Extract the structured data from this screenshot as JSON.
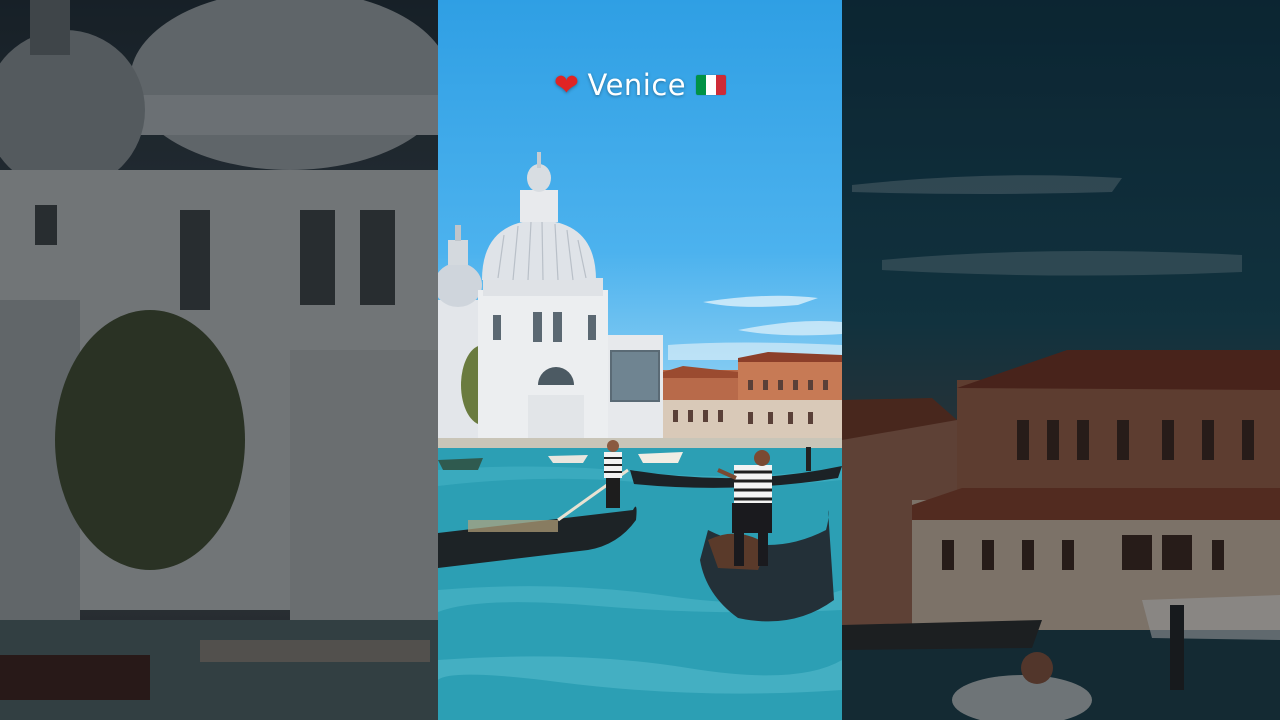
{
  "overlay": {
    "heart_glyph": "❤",
    "title": "Venice",
    "flag_icon": "italy-flag-icon",
    "flag_colors": [
      "#009246",
      "#ffffff",
      "#ce2b37"
    ]
  },
  "palette": {
    "sky": "#3aa8e8",
    "water": "#2c9fb4",
    "dome": "#dfe3e8",
    "gondola": "#1f2528"
  }
}
